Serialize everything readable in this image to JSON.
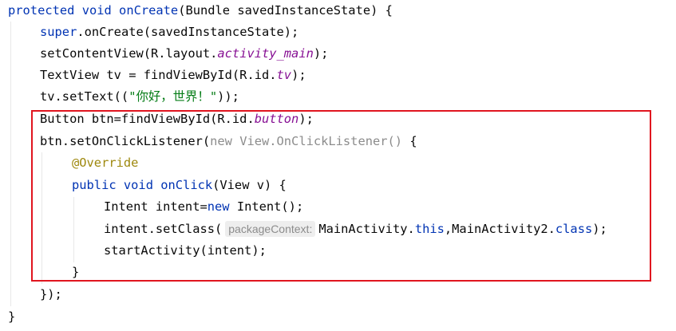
{
  "code": {
    "line1": {
      "kw1": "protected",
      "kw2": "void",
      "method": "onCreate",
      "rest": "(Bundle savedInstanceState) {"
    },
    "line2": {
      "kw": "super",
      "rest": ".onCreate(savedInstanceState);"
    },
    "line3": {
      "pre": "setContentView(R.layout.",
      "field": "activity_main",
      "post": ");"
    },
    "line4": {
      "pre": "TextView tv = findViewById(R.id.",
      "field": "tv",
      "post": ");"
    },
    "line5": {
      "pre": "tv.setText((",
      "str": "\"你好，世界！\"",
      "post": "));"
    },
    "line6": {
      "pre": "Button btn=findViewById(R.id.",
      "field": "button",
      "post": ");"
    },
    "line7": {
      "pre": "btn.setOnClickListener(",
      "gray": "new View.OnClickListener()",
      "post": " {"
    },
    "line8": {
      "anno": "@Override"
    },
    "line9": {
      "kw1": "public",
      "kw2": "void",
      "method": "onClick",
      "rest": "(View v) {"
    },
    "line10": {
      "pre": "Intent intent=",
      "kw": "new",
      "post": " Intent();"
    },
    "line11": {
      "pre": "intent.setClass(",
      "hint": "packageContext:",
      "mid": "MainActivity.",
      "kw1": "this",
      "mid2": ",MainActivity2.",
      "kw2": "class",
      "post": ");"
    },
    "line12": {
      "text": "startActivity(intent);"
    },
    "line13": {
      "text": "}"
    },
    "line14": {
      "text": "});"
    },
    "line15": {
      "text": "}"
    }
  },
  "highlight_color": "#e0151f"
}
